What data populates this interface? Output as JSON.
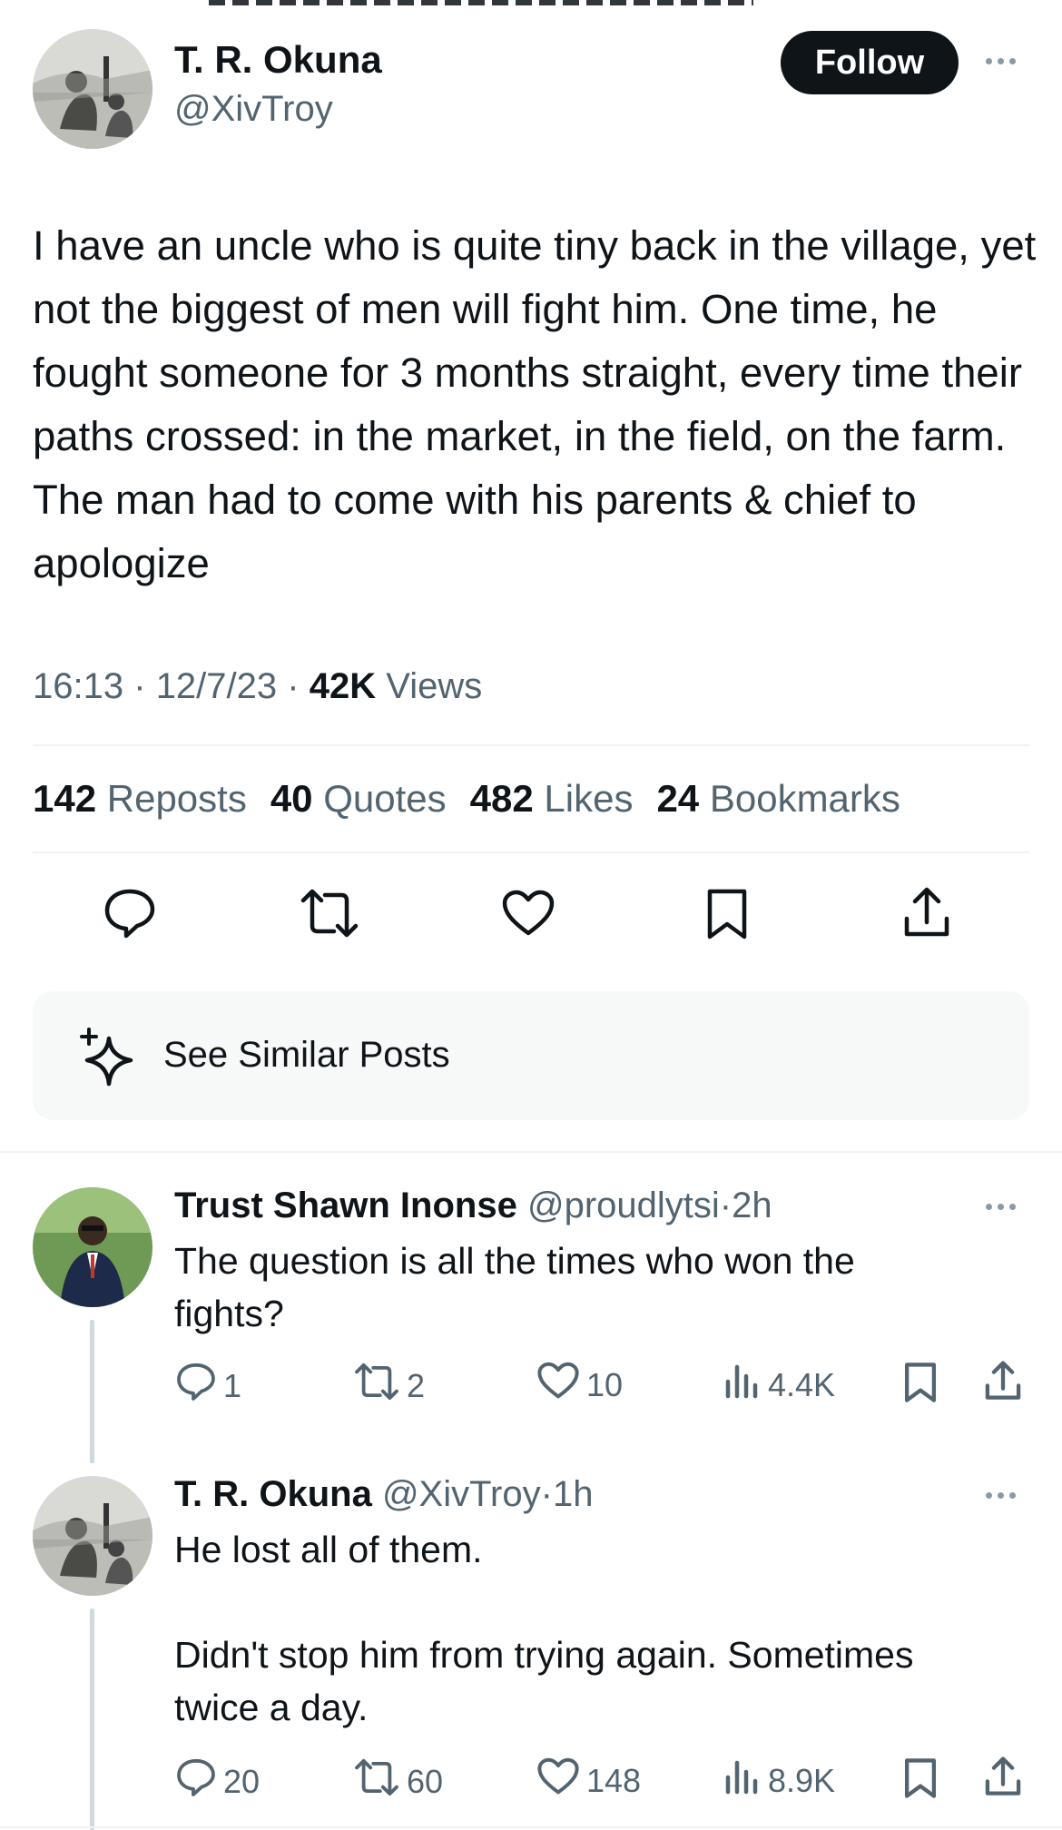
{
  "main_post": {
    "author_name": "T. R. Okuna",
    "author_handle": "@XivTroy",
    "follow_label": "Follow",
    "body": "I have an uncle who is quite tiny back in the village, yet not the biggest of men will fight him. One time, he fought someone for 3 months straight, every time their paths crossed: in the market, in the field, on the farm. The man had to come with his parents & chief to apologize",
    "time": "16:13",
    "date": "12/7/23",
    "sep": "·",
    "views_count": "42K",
    "views_label": "Views",
    "stats": [
      {
        "count": "142",
        "label": "Reposts"
      },
      {
        "count": "40",
        "label": "Quotes"
      },
      {
        "count": "482",
        "label": "Likes"
      },
      {
        "count": "24",
        "label": "Bookmarks"
      }
    ],
    "action_icons": [
      "reply-icon",
      "repost-icon",
      "like-icon",
      "bookmark-icon",
      "share-icon"
    ]
  },
  "similar": {
    "label": "See Similar Posts",
    "icon": "sparkle-icon"
  },
  "replies": [
    {
      "author_name": "Trust Shawn Inonse",
      "author_handle": "@proudlytsi",
      "sep": "·",
      "time": "2h",
      "lines": [
        "The question is all the times who won the",
        "fights?"
      ],
      "replies": "1",
      "reposts": "2",
      "likes": "10",
      "views": "4.4K"
    },
    {
      "author_name": "T. R. Okuna",
      "author_handle": "@XivTroy",
      "sep": "·",
      "time": "1h",
      "lines": [
        "He lost all of them.",
        "",
        "Didn't stop him from trying again. Sometimes",
        "twice a day."
      ],
      "replies": "20",
      "reposts": "60",
      "likes": "148",
      "views": "8.9K"
    }
  ],
  "colors": {
    "text": "#0f1419",
    "secondary": "#536471",
    "divider": "#eff3f4",
    "follow_bg": "#0f1419",
    "card_bg": "#f7f9f9"
  }
}
